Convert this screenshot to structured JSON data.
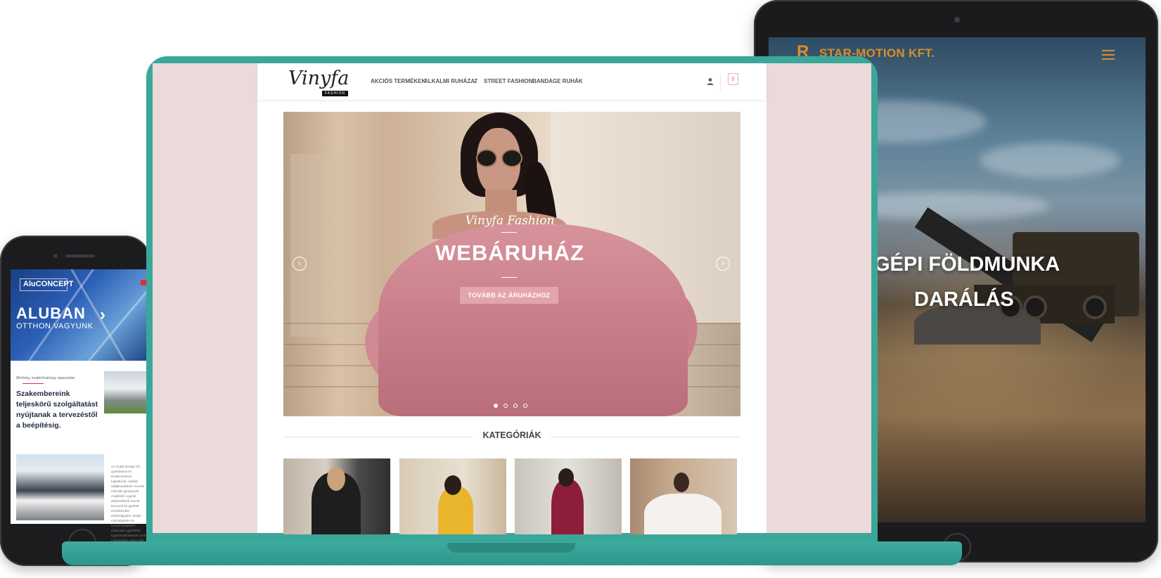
{
  "tablet_site": {
    "logo": "STAR-MOTION KFT.",
    "headline_1": "GÉPI FÖLDMUNKA",
    "headline_2": "DARÁLÁS"
  },
  "phone_site": {
    "logo": "AluCONCEPT",
    "hero_title": "ALUBAN",
    "hero_subtitle": "OTTHON VAGYUNK",
    "small_label": "Minőség, megbízhatóság, tapasztalat",
    "body_heading": "Szakembereink teljeskörű szolgáltatást nyújtanak a tervezéstől a beépítésig.",
    "paragraph": "Az Alulab Design Kft. gyártásával és kivitelezésével foglalkozik, családi vállalkozásként. Korunk műszaki igényeinek megfelelő, egyedi elképzelések szerint tervezett és gyártott termékeinket tartósságukért, kiváló minőségükért és korszerűségükért választják ügyfeleink. Együttműködésünk során maximálisan szem előtt tartjuk az Ön igényeit, és segítjük a megvalósítást a kezdetektől."
  },
  "laptop_site": {
    "logo_script": "Vinyfa",
    "logo_tag": "FASHION",
    "nav": [
      "AKCIÓS TERMÉKEK",
      "ALKALMI RUHÁZAT",
      "STREET FASHION",
      "BANDAGE RUHÁK"
    ],
    "nav_dropdown_icon": "chevron-down-icon",
    "cart_count": "0",
    "slider": {
      "script_text": "Vinyfa Fashion",
      "title": "WEBÁRUHÁZ",
      "button": "TOVÁBB AZ ÁRUHÁZHOZ",
      "prev": "‹",
      "next": "›",
      "slide_count": 4,
      "active_slide": 1
    },
    "categories_title": "KATEGÓRIÁK"
  },
  "colors": {
    "laptop_body": "#3aa799",
    "site_bg_pink": "#ecd9da",
    "button_pink": "#e4a4ab",
    "star_motion_orange": "#d98d2a",
    "alu_blue": "#2b5fb6",
    "alu_red": "#d3333a"
  }
}
